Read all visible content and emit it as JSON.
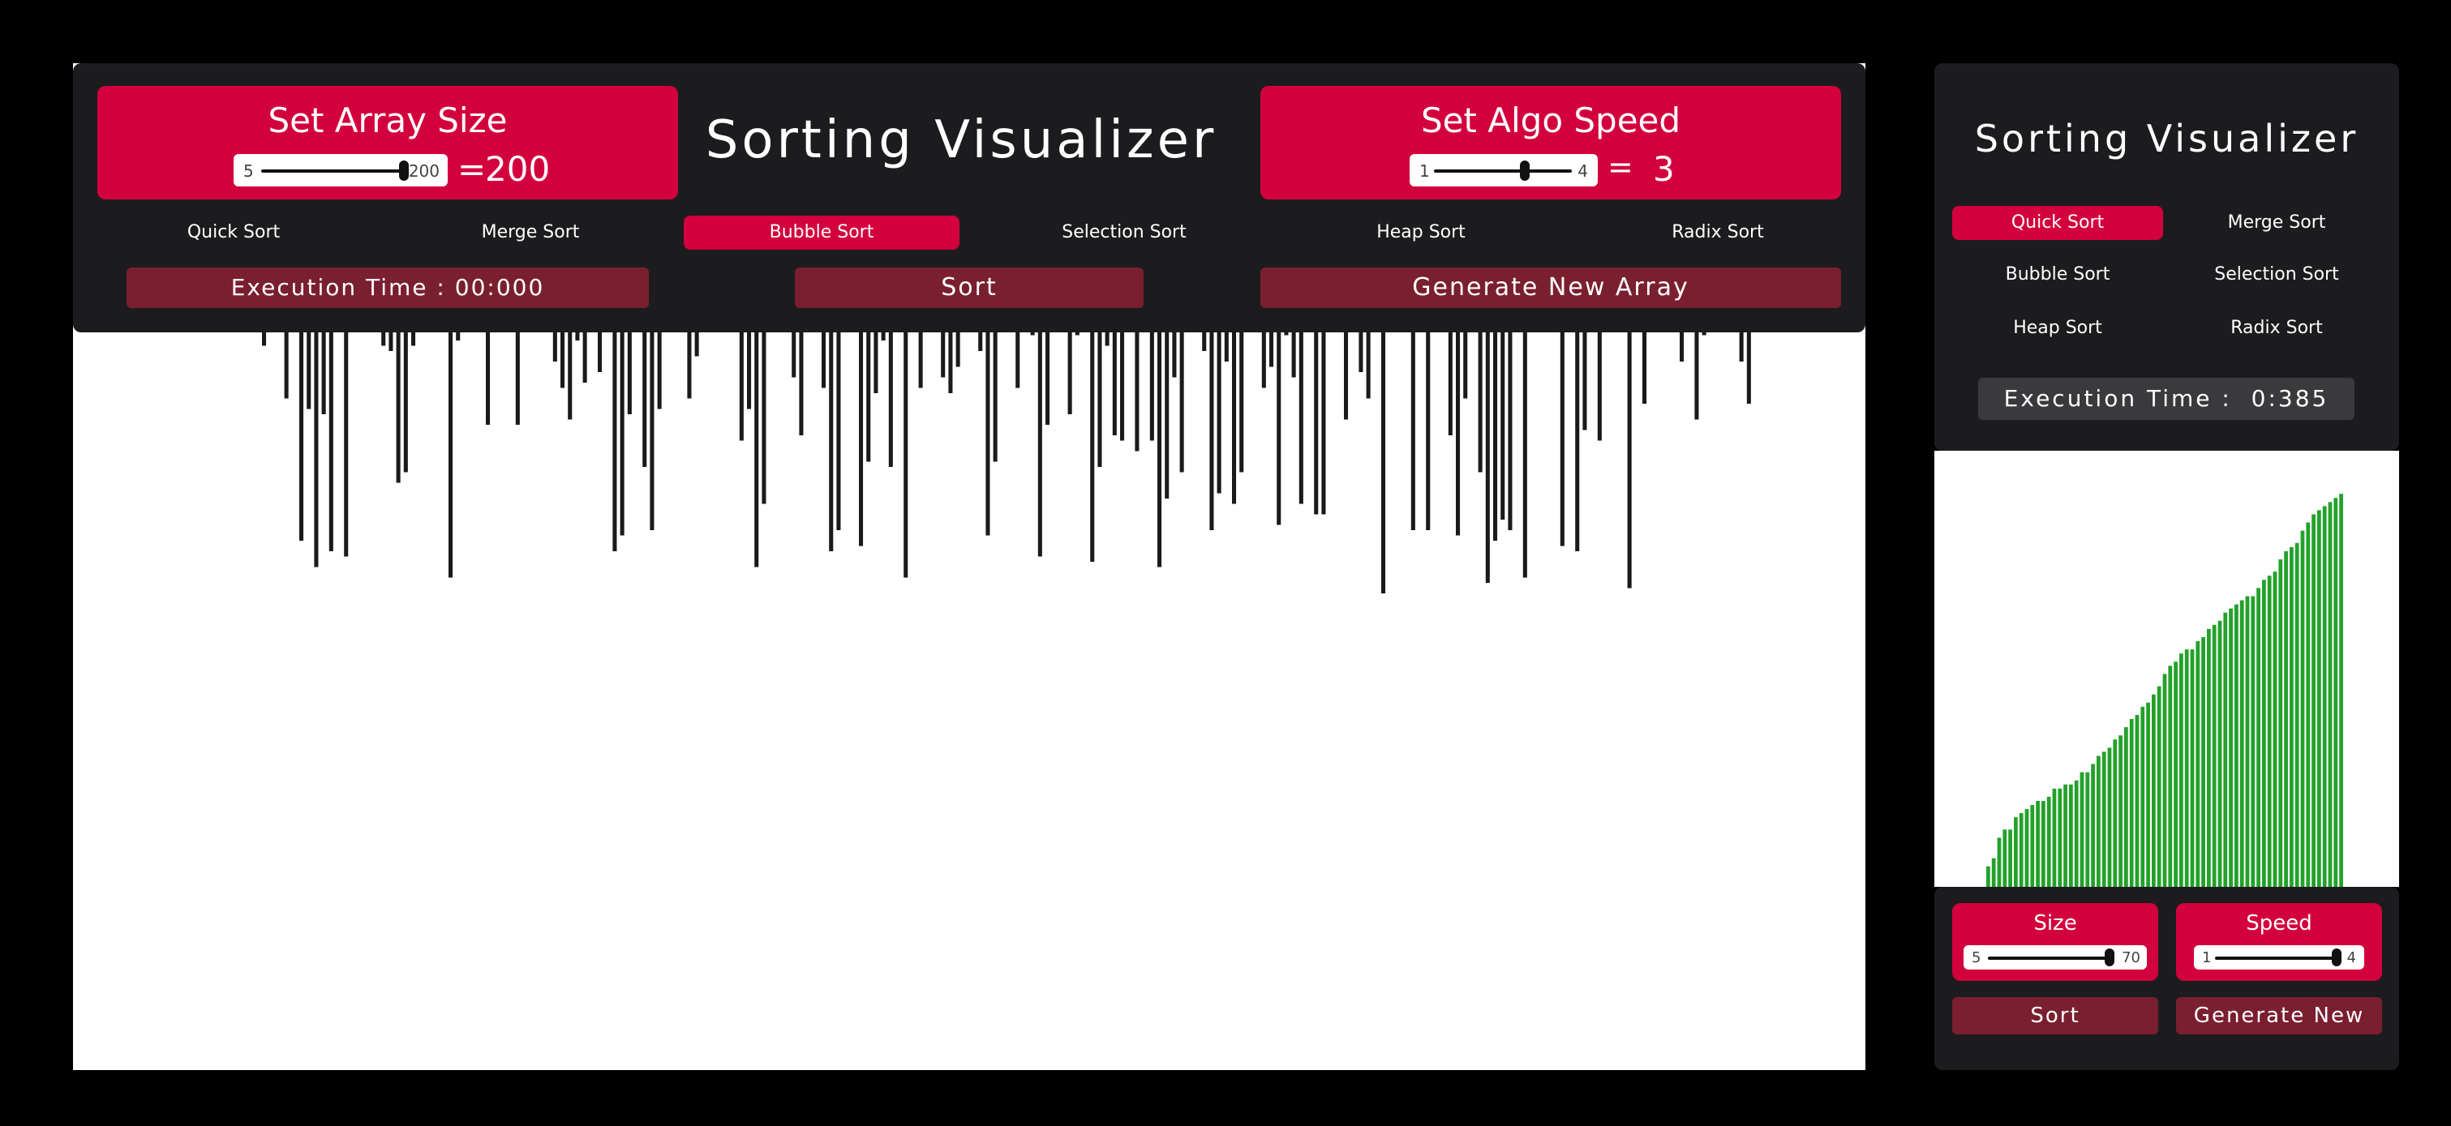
{
  "desktop": {
    "title": "Sorting Visualizer",
    "array_size": {
      "label": "Set Array Size",
      "min": "5",
      "max": "200",
      "equals": "=",
      "value": "200",
      "slider_fraction": 1.0
    },
    "algo_speed": {
      "label": "Set Algo Speed",
      "min": "1",
      "max": "4",
      "equals": "=",
      "value": "3",
      "slider_fraction": 0.66
    },
    "algorithms": [
      "Quick Sort",
      "Merge Sort",
      "Bubble Sort",
      "Selection Sort",
      "Heap Sort",
      "Radix Sort"
    ],
    "active_algorithm": "Bubble Sort",
    "execution_time": "Execution Time : 00:000",
    "sort_label": "Sort",
    "generate_label": "Generate New Array",
    "bar_color": "#1a1a1a"
  },
  "mobile": {
    "title": "Sorting Visualizer",
    "algorithms": [
      "Quick Sort",
      "Merge Sort",
      "Bubble Sort",
      "Selection Sort",
      "Heap Sort",
      "Radix Sort"
    ],
    "active_algorithm": "Quick Sort",
    "execution_time": "Execution Time :  0:385",
    "size": {
      "label": "Size",
      "min": "5",
      "max": "70",
      "slider_fraction": 1.0
    },
    "speed": {
      "label": "Speed",
      "min": "1",
      "max": "4",
      "slider_fraction": 1.0
    },
    "sort_label": "Sort",
    "generate_label": "Generate New",
    "bar_color": "#23a12a"
  },
  "colors": {
    "accent": "#d2003c",
    "panel": "#1c1c1e",
    "button_dark": "#7a1f30",
    "background": "#000000"
  },
  "chart_data": [
    {
      "type": "bar",
      "values": [
        0.49,
        0.29,
        0.28,
        0.59,
        0.36,
        0.86,
        0.61,
        0.91,
        0.62,
        0.88,
        0.41,
        0.89,
        0.13,
        0.21,
        0.46,
        0.4,
        0.49,
        0.5,
        0.75,
        0.73,
        0.49,
        0.37,
        0.16,
        0.2,
        0.34,
        0.93,
        0.48,
        0.23,
        0.41,
        0.33,
        0.64,
        0.11,
        0.06,
        0.27,
        0.64,
        0.09,
        0.31,
        0.44,
        0.37,
        0.52,
        0.57,
        0.63,
        0.48,
        0.56,
        0.37,
        0.54,
        0.46,
        0.88,
        0.85,
        0.62,
        0.41,
        0.72,
        0.84,
        0.61,
        0.32,
        0.19,
        0.44,
        0.59,
        0.51,
        0.39,
        0.36,
        0.08,
        0.08,
        0.02,
        0.67,
        0.61,
        0.91,
        0.79,
        0.12,
        0.36,
        0.46,
        0.55,
        0.66,
        0.24,
        0.26,
        0.57,
        0.88,
        0.84,
        0.1,
        0.29,
        0.87,
        0.71,
        0.58,
        0.48,
        0.72,
        0.18,
        0.93,
        0.4,
        0.57,
        0.13,
        0.27,
        0.55,
        0.58,
        0.53,
        0.2,
        0.45,
        0.5,
        0.85,
        0.71,
        0.25,
        0.17,
        0.57,
        0.27,
        0.47,
        0.89,
        0.64,
        0.04,
        0.38,
        0.62,
        0.47,
        0.25,
        0.9,
        0.72,
        0.49,
        0.66,
        0.67,
        0.42,
        0.69,
        0.2,
        0.67,
        0.91,
        0.78,
        0.55,
        0.73,
        0.34,
        0.1,
        0.5,
        0.84,
        0.77,
        0.52,
        0.79,
        0.73,
        0.04,
        0.31,
        0.57,
        0.53,
        0.83,
        0.47,
        0.55,
        0.79,
        0.4,
        0.81,
        0.81,
        0.43,
        0.2,
        0.63,
        0.43,
        0.54,
        0.59,
        0.05,
        0.96,
        0.31,
        0.44,
        0.37,
        0.84,
        0.1,
        0.84,
        0.39,
        0.39,
        0.66,
        0.85,
        0.59,
        0.21,
        0.73,
        0.94,
        0.86,
        0.82,
        0.84,
        0.27,
        0.93,
        0.36,
        0.06,
        0.16,
        0.16,
        0.87,
        0.42,
        0.88,
        0.65,
        0.03,
        0.67,
        0.15,
        0.34,
        0.33,
        0.95,
        0.21,
        0.6,
        0.09,
        0.4,
        0.2,
        0.44,
        0.52,
        0.46,
        0.63,
        0.47,
        0.34,
        0.22,
        0.1,
        0.11,
        0.52,
        0.6
      ],
      "ylim": [
        0,
        1
      ]
    },
    {
      "type": "bar",
      "values": [
        0.05,
        0.07,
        0.12,
        0.14,
        0.14,
        0.17,
        0.18,
        0.19,
        0.2,
        0.21,
        0.21,
        0.22,
        0.24,
        0.24,
        0.25,
        0.25,
        0.26,
        0.28,
        0.28,
        0.3,
        0.32,
        0.33,
        0.34,
        0.36,
        0.37,
        0.39,
        0.41,
        0.42,
        0.44,
        0.45,
        0.47,
        0.49,
        0.52,
        0.54,
        0.55,
        0.57,
        0.58,
        0.58,
        0.6,
        0.61,
        0.63,
        0.64,
        0.65,
        0.67,
        0.68,
        0.69,
        0.7,
        0.71,
        0.71,
        0.73,
        0.75,
        0.76,
        0.77,
        0.8,
        0.82,
        0.83,
        0.84,
        0.87,
        0.89,
        0.91,
        0.92,
        0.93,
        0.94,
        0.95,
        0.96
      ],
      "ylim": [
        0,
        1
      ]
    }
  ]
}
